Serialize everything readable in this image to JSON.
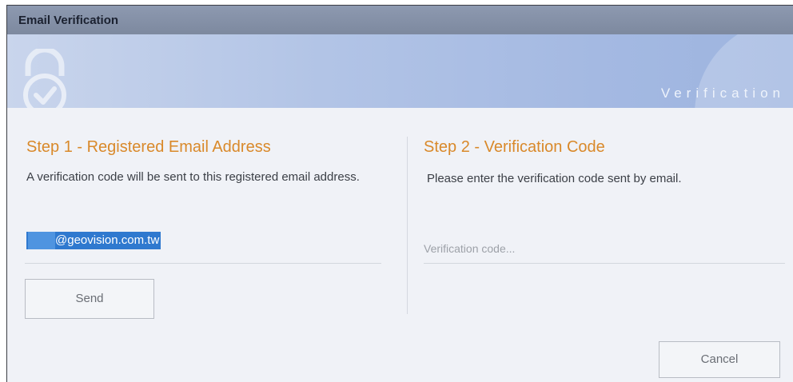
{
  "window": {
    "title": "Email Verification"
  },
  "banner": {
    "word": "Verification",
    "icon": "lock-check-icon"
  },
  "step1": {
    "title": "Step 1 - Registered Email Address",
    "description": "A verification code will be sent to this registered email address.",
    "email_value": "@geovision.com.tw",
    "send_label": "Send"
  },
  "step2": {
    "title": "Step 2 - Verification Code",
    "description": "Please enter the verification code sent by email.",
    "code_value": "",
    "code_placeholder": "Verification code..."
  },
  "footer": {
    "cancel_label": "Cancel"
  },
  "colors": {
    "accent": "#d9892a",
    "selection": "#2f79cf",
    "titlebar": "#8593aa"
  }
}
